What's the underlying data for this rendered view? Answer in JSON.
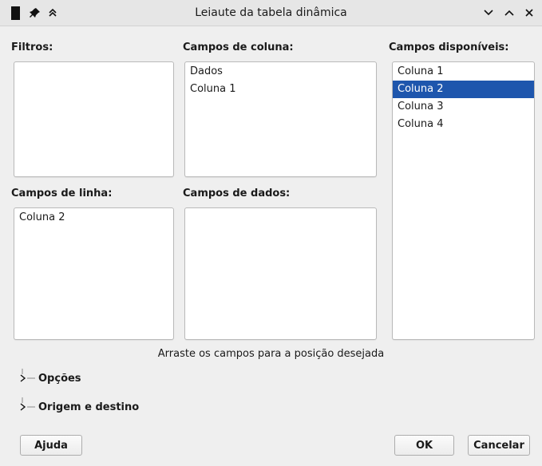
{
  "window": {
    "title": "Leiaute da tabela dinâmica"
  },
  "titlebar_icons": [
    "app-block-icon",
    "pin-icon",
    "shade-icon",
    "minimize-icon",
    "maximize-icon",
    "close-icon"
  ],
  "filters": {
    "label": "Filtros:",
    "items": []
  },
  "column_fields": {
    "label": "Campos de coluna:",
    "items": [
      "Dados",
      "Coluna 1"
    ]
  },
  "available_fields": {
    "label": "Campos disponíveis:",
    "items": [
      "Coluna 1",
      "Coluna 2",
      "Coluna 3",
      "Coluna 4"
    ],
    "selected": "Coluna 2"
  },
  "row_fields": {
    "label": "Campos de linha:",
    "items": [
      "Coluna 2"
    ]
  },
  "data_fields": {
    "label": "Campos de dados:",
    "items": []
  },
  "hint": "Arraste os campos para a posição desejada",
  "expanders": {
    "options": "Opções",
    "source_dest": "Origem e destino"
  },
  "buttons": {
    "help": "Ajuda",
    "ok": "OK",
    "cancel": "Cancelar"
  },
  "colors": {
    "selection": "#1e56ad",
    "background": "#efefef"
  }
}
